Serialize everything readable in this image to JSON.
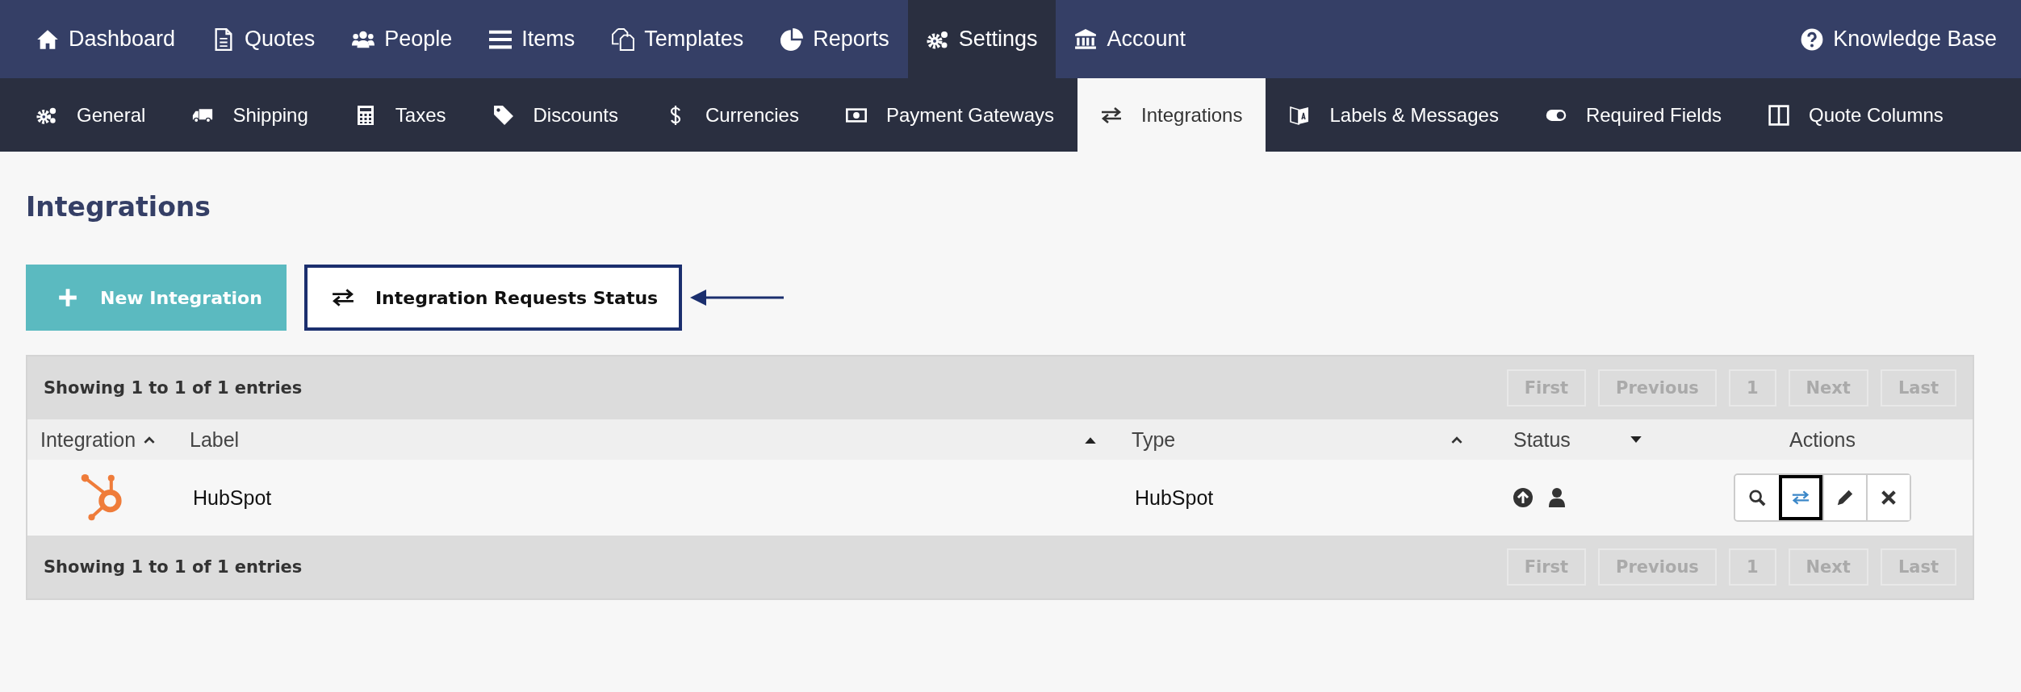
{
  "top_nav": {
    "items": [
      {
        "label": "Dashboard",
        "selected": false
      },
      {
        "label": "Quotes",
        "selected": false
      },
      {
        "label": "People",
        "selected": false
      },
      {
        "label": "Items",
        "selected": false
      },
      {
        "label": "Templates",
        "selected": false
      },
      {
        "label": "Reports",
        "selected": false
      },
      {
        "label": "Settings",
        "selected": true
      },
      {
        "label": "Account",
        "selected": false
      }
    ],
    "help_link": "Knowledge Base"
  },
  "sub_nav": {
    "tabs": [
      {
        "label": "General",
        "selected": false
      },
      {
        "label": "Shipping",
        "selected": false
      },
      {
        "label": "Taxes",
        "selected": false
      },
      {
        "label": "Discounts",
        "selected": false
      },
      {
        "label": "Currencies",
        "selected": false
      },
      {
        "label": "Payment Gateways",
        "selected": false
      },
      {
        "label": "Integrations",
        "selected": true
      },
      {
        "label": "Labels & Messages",
        "selected": false
      },
      {
        "label": "Required Fields",
        "selected": false
      },
      {
        "label": "Quote Columns",
        "selected": false
      }
    ]
  },
  "page_title": "Integrations",
  "buttons": [
    {
      "label": "New Integration",
      "kind": "primary",
      "highlighted": false
    },
    {
      "label": "Integration Requests Status",
      "kind": "secondary",
      "highlighted": true
    }
  ],
  "table": {
    "info_top": "Showing 1 to 1 of 1 entries",
    "info_bottom": "Showing 1 to 1 of 1 entries",
    "pagination_top": [
      {
        "label": "First",
        "disabled": true
      },
      {
        "label": "Previous",
        "disabled": true
      },
      {
        "label": "1",
        "disabled": true
      },
      {
        "label": "Next",
        "disabled": true
      },
      {
        "label": "Last",
        "disabled": true
      }
    ],
    "pagination_bottom": [
      {
        "label": "First",
        "disabled": true
      },
      {
        "label": "Previous",
        "disabled": true
      },
      {
        "label": "1",
        "disabled": true
      },
      {
        "label": "Next",
        "disabled": true
      },
      {
        "label": "Last",
        "disabled": true
      }
    ],
    "columns": [
      {
        "label": "Integration",
        "kind": "chevron"
      },
      {
        "label": "Label",
        "kind": "uptriangle"
      },
      {
        "label": "Type",
        "kind": "chevron"
      },
      {
        "label": "Status",
        "kind": "downtriangle"
      },
      {
        "label": "Actions",
        "kind": "plain"
      }
    ],
    "rows": [
      {
        "label": "HubSpot",
        "type": "HubSpot",
        "actions": [
          {
            "kind": "view",
            "highlighted": false
          },
          {
            "kind": "sync",
            "highlighted": true
          },
          {
            "kind": "edit",
            "highlighted": false
          },
          {
            "kind": "delete",
            "highlighted": false
          }
        ]
      }
    ]
  }
}
